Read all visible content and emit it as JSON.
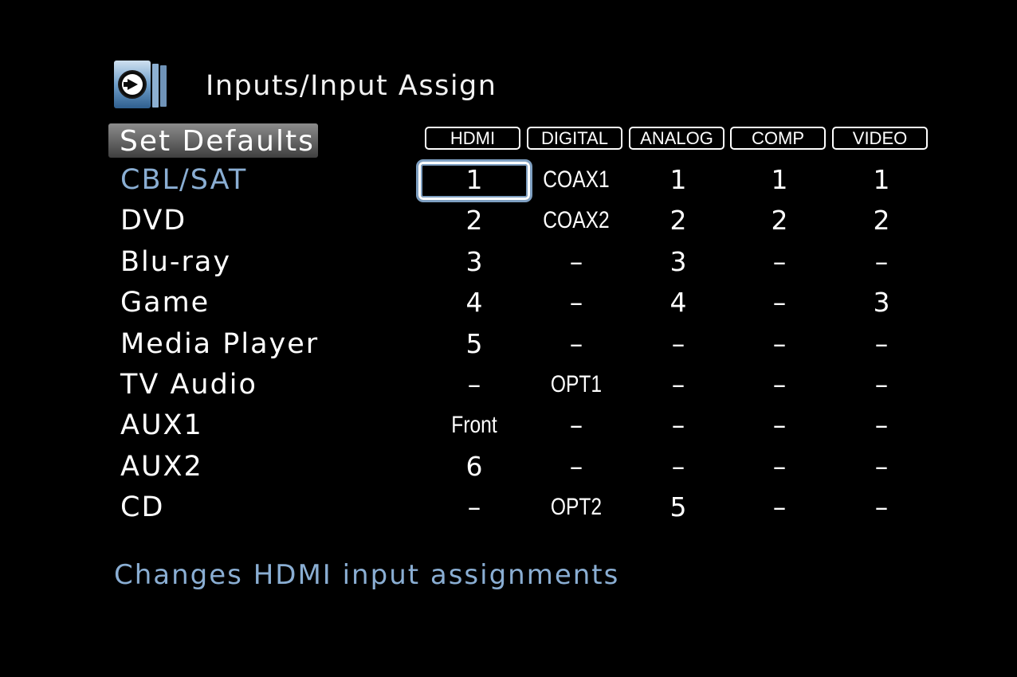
{
  "header": {
    "title": "Inputs/Input Assign",
    "icon": "inputs-menu-icon"
  },
  "set_defaults_label": "Set Defaults",
  "columns": [
    "HDMI",
    "DIGITAL",
    "ANALOG",
    "COMP",
    "VIDEO"
  ],
  "rows": [
    {
      "label": "CBL/SAT",
      "cells": [
        "1",
        "COAX1",
        "1",
        "1",
        "1"
      ],
      "selected": true
    },
    {
      "label": "DVD",
      "cells": [
        "2",
        "COAX2",
        "2",
        "2",
        "2"
      ]
    },
    {
      "label": "Blu-ray",
      "cells": [
        "3",
        "–",
        "3",
        "–",
        "–"
      ]
    },
    {
      "label": "Game",
      "cells": [
        "4",
        "–",
        "4",
        "–",
        "3"
      ]
    },
    {
      "label": "Media Player",
      "cells": [
        "5",
        "–",
        "–",
        "–",
        "–"
      ]
    },
    {
      "label": "TV Audio",
      "cells": [
        "–",
        "OPT1",
        "–",
        "–",
        "–"
      ]
    },
    {
      "label": "AUX1",
      "cells": [
        "Front",
        "–",
        "–",
        "–",
        "–"
      ]
    },
    {
      "label": "AUX2",
      "cells": [
        "6",
        "–",
        "–",
        "–",
        "–"
      ]
    },
    {
      "label": "CD",
      "cells": [
        "–",
        "OPT2",
        "5",
        "–",
        "–"
      ]
    }
  ],
  "help_text": "Changes HDMI input assignments",
  "colors": {
    "background": "#000000",
    "text": "#ffffff",
    "highlight": "#8aaed3",
    "cursor_glow": "#7e9fc1"
  }
}
